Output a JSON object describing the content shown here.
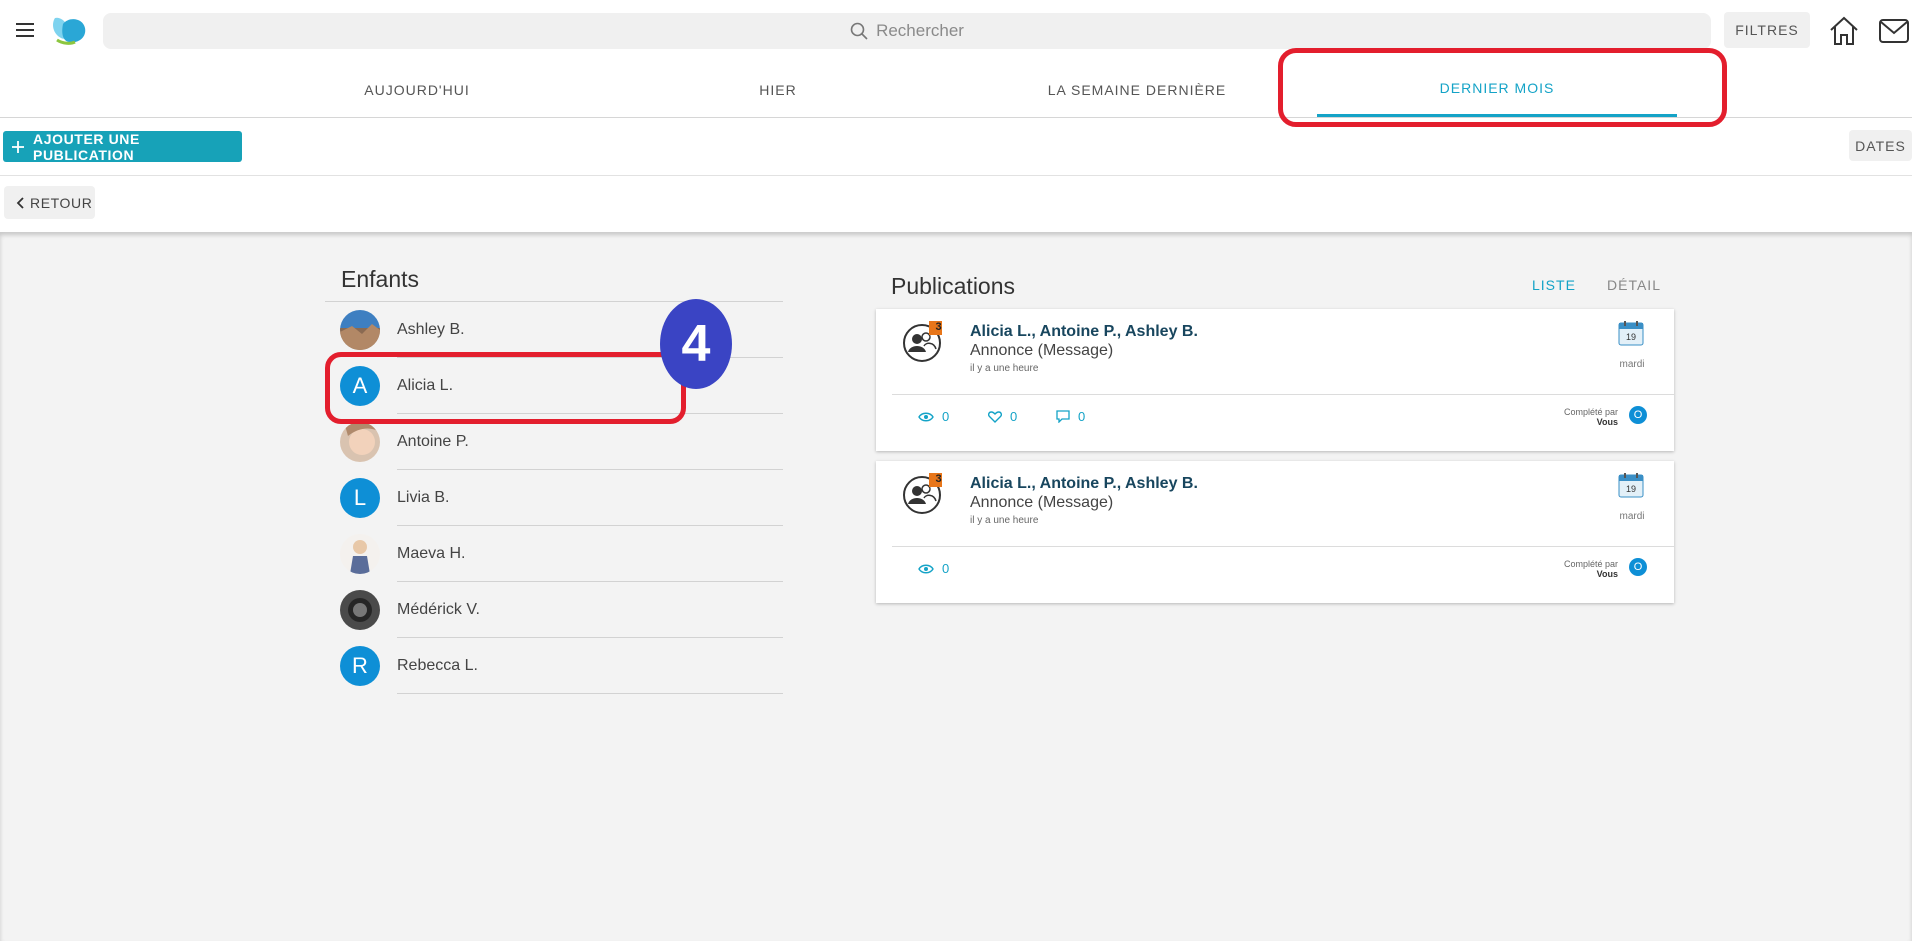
{
  "header": {
    "search_placeholder": "Rechercher",
    "filters_label": "FILTRES"
  },
  "tabs": [
    {
      "label": "AUJOURD'HUI",
      "active": false
    },
    {
      "label": "HIER",
      "active": false
    },
    {
      "label": "LA SEMAINE DERNIÈRE",
      "active": false
    },
    {
      "label": "DERNIER MOIS",
      "active": true
    }
  ],
  "toolbar": {
    "add_label": "AJOUTER UNE PUBLICATION",
    "dates_label": "DATES",
    "back_label": "RETOUR"
  },
  "annotation": {
    "step": "4",
    "color": "#e31e2d",
    "badge_color": "#3a44c4"
  },
  "children": {
    "title": "Enfants",
    "items": [
      {
        "name": "Ashley B.",
        "avatar": "photo"
      },
      {
        "name": "Alicia L.",
        "avatar": "A"
      },
      {
        "name": "Antoine P.",
        "avatar": "photo"
      },
      {
        "name": "Livia B.",
        "avatar": "L"
      },
      {
        "name": "Maeva H.",
        "avatar": "photo"
      },
      {
        "name": "Médérick V.",
        "avatar": "photo"
      },
      {
        "name": "Rebecca L.",
        "avatar": "R"
      }
    ]
  },
  "publications": {
    "title": "Publications",
    "view_list": "LISTE",
    "view_detail": "DÉTAIL",
    "items": [
      {
        "group_count": "3",
        "names": "Alicia L., Antoine P., Ashley B.",
        "subtitle": "Annonce (Message)",
        "time_ago": "il y a une heure",
        "calendar_day": "19",
        "weekday": "mardi",
        "views": "0",
        "likes": "0",
        "comments": "0",
        "completed_label": "Complété par",
        "completed_by": "Vous",
        "completed_initial": "O"
      },
      {
        "group_count": "3",
        "names": "Alicia L., Antoine P., Ashley B.",
        "subtitle": "Annonce (Message)",
        "time_ago": "il y a une heure",
        "calendar_day": "19",
        "weekday": "mardi",
        "views": "0",
        "completed_label": "Complété par",
        "completed_by": "Vous",
        "completed_initial": "O"
      }
    ]
  },
  "colors": {
    "accent": "#14a3c7",
    "button": "#17a2b8",
    "avatar": "#0e8fd6",
    "badge": "#e8761a"
  }
}
